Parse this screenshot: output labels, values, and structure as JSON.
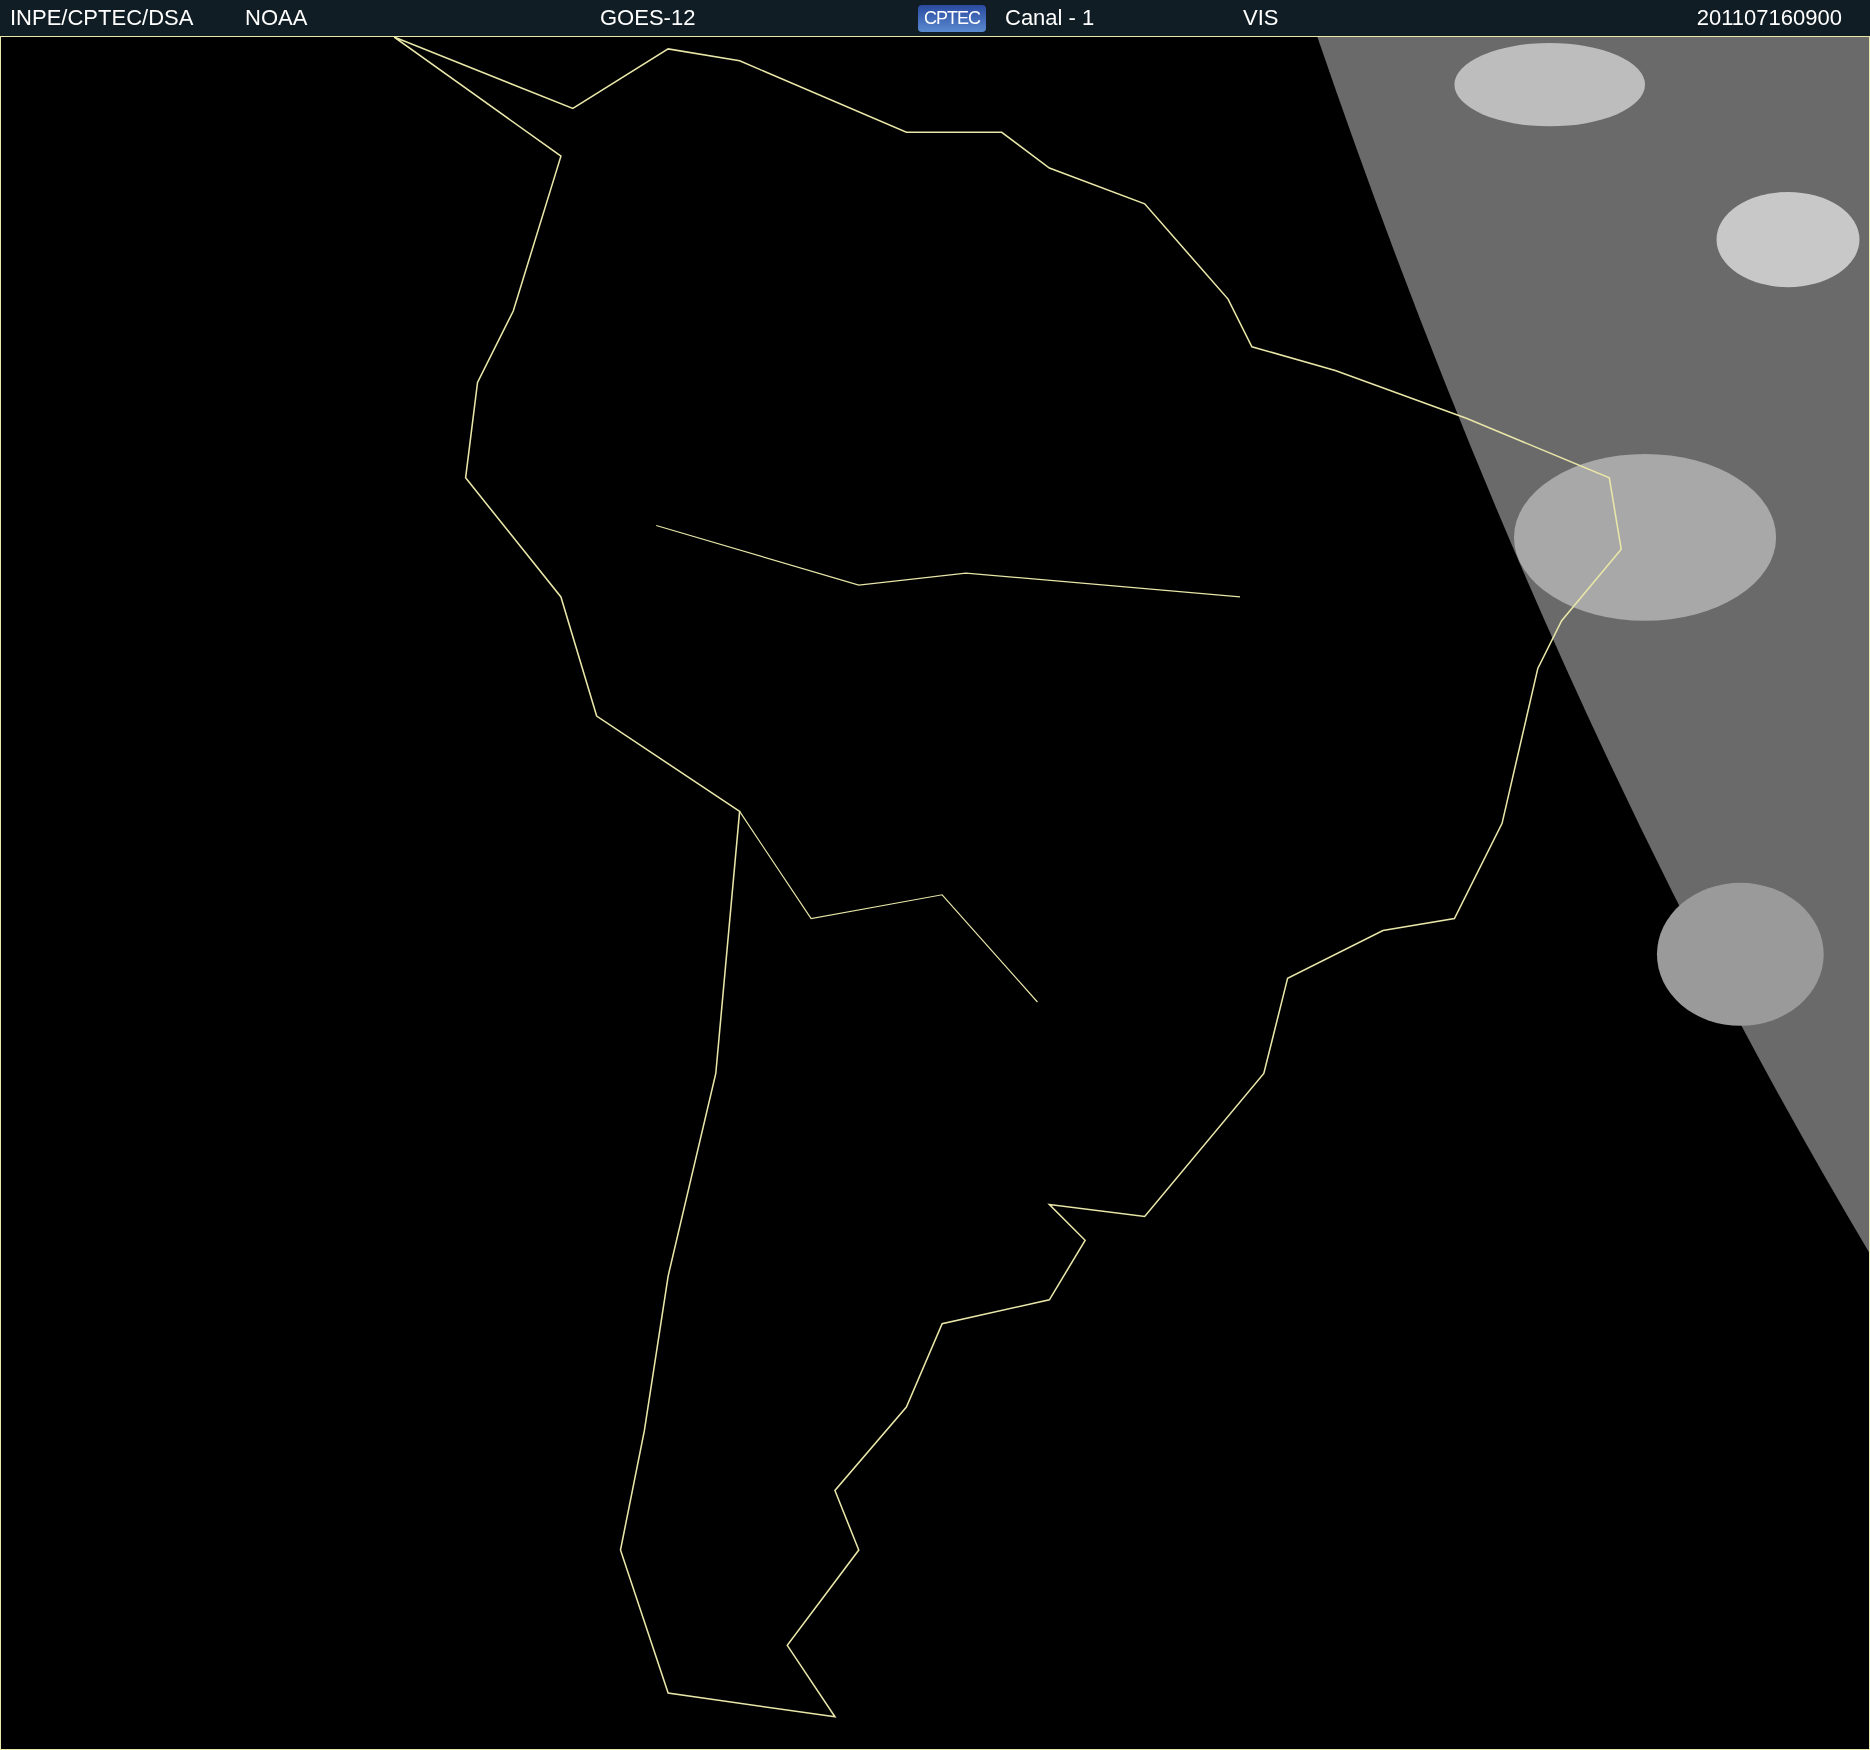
{
  "header": {
    "items": [
      {
        "kind": "text",
        "text": "INPE/CPTEC/DSA"
      },
      {
        "kind": "text",
        "text": "NOAA"
      },
      {
        "kind": "text",
        "text": "GOES-12"
      },
      {
        "kind": "logo",
        "text": "CPTEC"
      },
      {
        "kind": "text",
        "text": "Canal - 1"
      },
      {
        "kind": "text",
        "text": "VIS"
      },
      {
        "kind": "text",
        "text": "201107160900"
      }
    ]
  }
}
